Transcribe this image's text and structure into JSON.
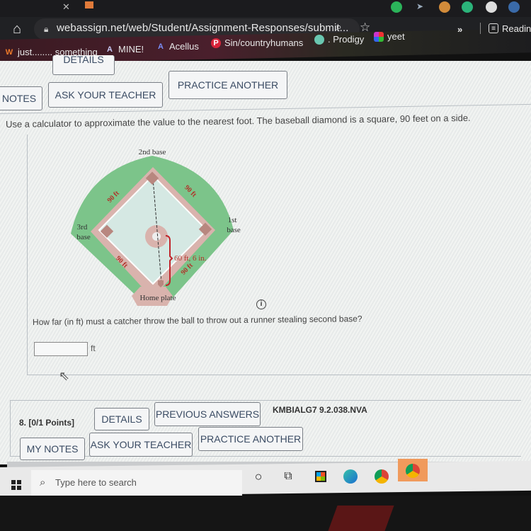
{
  "browser": {
    "url": "webassign.net/web/Student/Assignment-Responses/submit...",
    "bookmarks": [
      {
        "label": "just........ something",
        "icon": "w-logo-icon"
      },
      {
        "label": "MINE!",
        "icon": "acellus-a-icon"
      },
      {
        "label": "Acellus",
        "icon": "acellus-a-icon"
      },
      {
        "label": "Sin/countryhumans",
        "icon": "pinterest-icon"
      },
      {
        "label": ". Prodigy",
        "icon": "prodigy-icon"
      },
      {
        "label": "yeet",
        "icon": "colorful-tile-icon"
      }
    ],
    "more_label": "»",
    "reading_list_label": "Reading"
  },
  "question7": {
    "buttons": {
      "details": "DETAILS",
      "notes": "NOTES",
      "ask_teacher": "ASK YOUR TEACHER",
      "practice_another": "PRACTICE ANOTHER"
    },
    "instruction": "Use a calculator to approximate the value to the nearest foot. The baseball diamond is a square, 90 feet on a side.",
    "diagram": {
      "second_base": "2nd base",
      "first_base_line1": "1st",
      "first_base_line2": "base",
      "third_base_line1": "3rd",
      "third_base_line2": "base",
      "home_plate": "Home plate",
      "side_label": "90 ft",
      "mound_distance": "60 ft, 6 in."
    },
    "question": "How far (in ft) must a catcher throw the ball to throw out a runner stealing second base?",
    "answer_value": "",
    "unit": "ft"
  },
  "question8": {
    "number": "8.  [0/1 Points]",
    "code": "KMBIALG7 9.2.038.NVA",
    "buttons": {
      "details": "DETAILS",
      "previous_answers": "PREVIOUS ANSWERS",
      "my_notes": "MY NOTES",
      "ask_teacher": "ASK YOUR TEACHER",
      "practice_another": "PRACTICE ANOTHER"
    }
  },
  "taskbar": {
    "search_placeholder": "Type here to search"
  },
  "colors": {
    "field_green": "#7cc48a",
    "dirt": "#d9b3ad",
    "infield": "#d5e8e3",
    "label_red": "#b0342a",
    "button_text": "#3a4b63"
  }
}
